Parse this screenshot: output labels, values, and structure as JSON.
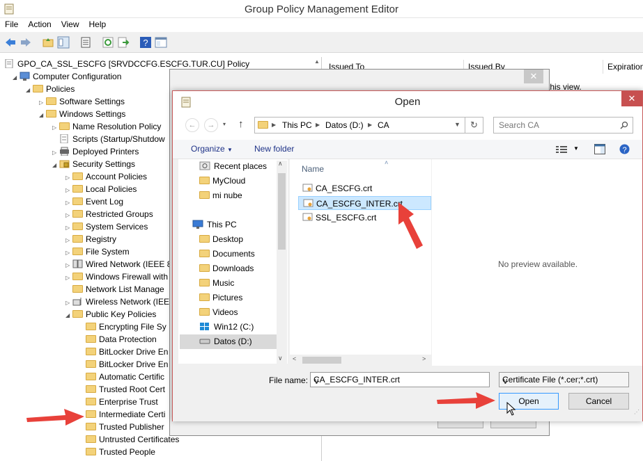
{
  "window": {
    "title": "Group Policy Management Editor"
  },
  "menu": [
    "File",
    "Action",
    "View",
    "Help"
  ],
  "tree": {
    "root": "GPO_CA_SSL_ESCFG [SRVDCCFG.ESCFG.TUR.CU] Policy",
    "items": [
      "Computer Configuration",
      "Policies",
      "Software Settings",
      "Windows Settings",
      "Name Resolution Policy",
      "Scripts (Startup/Shutdow",
      "Deployed Printers",
      "Security Settings",
      "Account Policies",
      "Local Policies",
      "Event Log",
      "Restricted Groups",
      "System Services",
      "Registry",
      "File System",
      "Wired Network (IEEE 8",
      "Windows Firewall with",
      "Network List Manage",
      "Wireless Network (IEE",
      "Public Key Policies",
      "Encrypting File Sy",
      "Data Protection",
      "BitLocker Drive En",
      "BitLocker Drive En",
      "Automatic Certific",
      "Trusted Root Cert",
      "Enterprise Trust",
      "Intermediate Certi",
      "Trusted Publisher",
      "Untrusted Certificates",
      "Trusted People"
    ]
  },
  "right_pane": {
    "columns": [
      "Issued To",
      "Issued By",
      "Expiration"
    ],
    "partial_text": "n this view."
  },
  "dialog": {
    "title": "Open",
    "close_glyph": "✕",
    "breadcrumb": [
      "This PC",
      "Datos (D:)",
      "CA"
    ],
    "search_placeholder": "Search CA",
    "organize_label": "Organize",
    "new_folder_label": "New folder",
    "nav_items": {
      "favorites": [
        "Recent places",
        "MyCloud",
        "mi nube"
      ],
      "this_pc": "This PC",
      "pc_items": [
        "Desktop",
        "Documents",
        "Downloads",
        "Music",
        "Pictures",
        "Videos",
        "Win12 (C:)",
        "Datos (D:)"
      ]
    },
    "column_name": "Name",
    "files": [
      "CA_ESCFG.crt",
      "CA_ESCFG_INTER.crt",
      "SSL_ESCFG.crt"
    ],
    "selected_file": "CA_ESCFG_INTER.crt",
    "preview_text": "No preview available.",
    "file_name_label": "File name:",
    "file_name_value": "CA_ESCFG_INTER.crt",
    "file_type_value": "Certificate File (*.cer;*.crt)",
    "open_label": "Open",
    "cancel_label": "Cancel"
  },
  "colors": {
    "arrow": "#e8413a",
    "folder": "#f3d27a",
    "selection": "#cce8ff",
    "link": "#1e3287"
  }
}
